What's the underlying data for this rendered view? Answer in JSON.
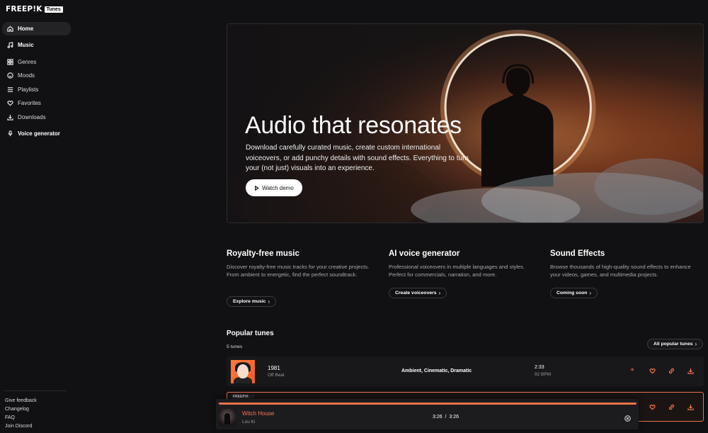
{
  "brand": {
    "name": "FREEP!K",
    "badge": "Tunes"
  },
  "sidebar": {
    "items": [
      {
        "label": "Home",
        "icon": "home-icon",
        "active": true
      },
      {
        "label": "Music",
        "icon": "music-note-icon"
      },
      {
        "label": "Genres",
        "icon": "grid-icon"
      },
      {
        "label": "Moods",
        "icon": "smiley-icon"
      },
      {
        "label": "Playlists",
        "icon": "list-icon"
      },
      {
        "label": "Favorites",
        "icon": "heart-icon"
      },
      {
        "label": "Downloads",
        "icon": "download-icon"
      },
      {
        "label": "Voice generator",
        "icon": "microphone-icon"
      }
    ],
    "footer": [
      "Give feedback",
      "Changelog",
      "FAQ",
      "Join Discord"
    ]
  },
  "hero": {
    "title": "Audio that resonates",
    "description": "Download carefully curated music, create custom international voiceovers, or add punchy details with sound effects. Everything to turn your (not just) visuals into an experience.",
    "button": "Watch demo"
  },
  "features": [
    {
      "title": "Royalty-free music",
      "description": "Discover royalty-free music tracks for your creative projects. From ambient to energetic, find the perfect soundtrack.",
      "button": "Explore music"
    },
    {
      "title": "AI voice generator",
      "description": "Professional voiceovers in multiple languages and styles. Perfect for commercials, narration, and more.",
      "button": "Create voiceovers"
    },
    {
      "title": "Sound Effects",
      "description": "Browse thousands of high-quality sound effects to enhance your videos, games, and multimedia projects.",
      "button": "Coming soon"
    }
  ],
  "popular": {
    "title": "Popular tunes",
    "count": "5 tunes",
    "all_button": "All popular tunes",
    "tracks": [
      {
        "title": "1981",
        "artist": "Off Beat",
        "tags": "Ambient, Cinematic, Dramatic",
        "duration": "2:33",
        "bpm": "92 BPM"
      }
    ],
    "row2_cover_text": "FREEP!K"
  },
  "player": {
    "title": "Witch House",
    "artist": "Lou Ki",
    "elapsed": "3:26",
    "separator": "/",
    "total": "3:26",
    "progress": 1.0
  },
  "colors": {
    "accent": "#ff7449",
    "background": "#111113"
  }
}
